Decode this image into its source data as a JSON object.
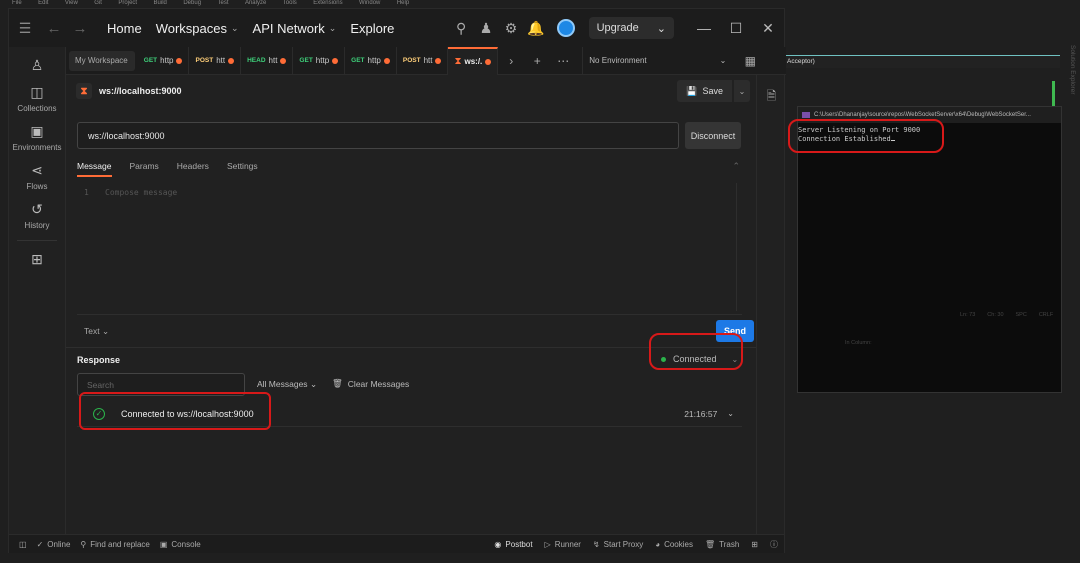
{
  "background_app": {
    "menu_items": [
      "File",
      "Edit",
      "View",
      "Git",
      "Project",
      "Build",
      "Debug",
      "Test",
      "Analyze",
      "Tools",
      "Extensions",
      "Window",
      "Help"
    ],
    "dropdown_text": "Acceptor)",
    "side_panel_label": "Solution Explorer",
    "status": {
      "ln": "Ln: 73",
      "ch": "Ch: 30",
      "spc": "SPC",
      "crlf": "CRLF",
      "in_column": "In Column:"
    }
  },
  "console": {
    "title": "C:\\Users\\Dhananjay\\source\\repos\\WebSocketServer\\x64\\Debug\\WebSocketSer...",
    "lines": [
      "Server Listening on Port 9000",
      "Connection Established"
    ]
  },
  "header": {
    "nav": [
      "Home",
      "Workspaces",
      "API Network",
      "Explore"
    ],
    "upgrade_label": "Upgrade"
  },
  "sidebar": {
    "items": [
      {
        "label": "Collections",
        "icon": "collections-icon"
      },
      {
        "label": "Environments",
        "icon": "environments-icon"
      },
      {
        "label": "Flows",
        "icon": "flows-icon"
      },
      {
        "label": "History",
        "icon": "history-icon"
      }
    ]
  },
  "tabs": {
    "workspace_label": "My Workspace",
    "items": [
      {
        "method": "GET",
        "label": "http",
        "color": "#3ed07a"
      },
      {
        "method": "POST",
        "label": "htt",
        "color": "#ffcf7a"
      },
      {
        "method": "HEAD",
        "label": "htt",
        "color": "#3ed07a"
      },
      {
        "method": "GET",
        "label": "http",
        "color": "#3ed07a"
      },
      {
        "method": "GET",
        "label": "http",
        "color": "#3ed07a"
      },
      {
        "method": "POST",
        "label": "htt",
        "color": "#ffcf7a"
      }
    ],
    "active_label": "ws:/.",
    "environment": "No Environment"
  },
  "request": {
    "title": "ws://localhost:9000",
    "save_label": "Save",
    "url": "ws://localhost:9000",
    "disconnect_label": "Disconnect",
    "sub_tabs": [
      "Message",
      "Params",
      "Headers",
      "Settings"
    ],
    "editor_line": "1",
    "editor_placeholder": "Compose message",
    "format": "Text",
    "send_label": "Send"
  },
  "response": {
    "label": "Response",
    "status": "Connected",
    "search_placeholder": "Search",
    "filter": "All Messages",
    "clear_label": "Clear Messages",
    "messages": [
      {
        "text": "Connected to ws://localhost:9000",
        "time": "21:16:57"
      }
    ]
  },
  "statusbar": {
    "online": "Online",
    "find_replace": "Find and replace",
    "console": "Console",
    "postbot": "Postbot",
    "runner": "Runner",
    "start_proxy": "Start Proxy",
    "cookies": "Cookies",
    "trash": "Trash"
  },
  "colors": {
    "accent": "#ff6c37",
    "send": "#1d79e6",
    "connected": "#2bb34b",
    "annotation": "#d71919"
  }
}
